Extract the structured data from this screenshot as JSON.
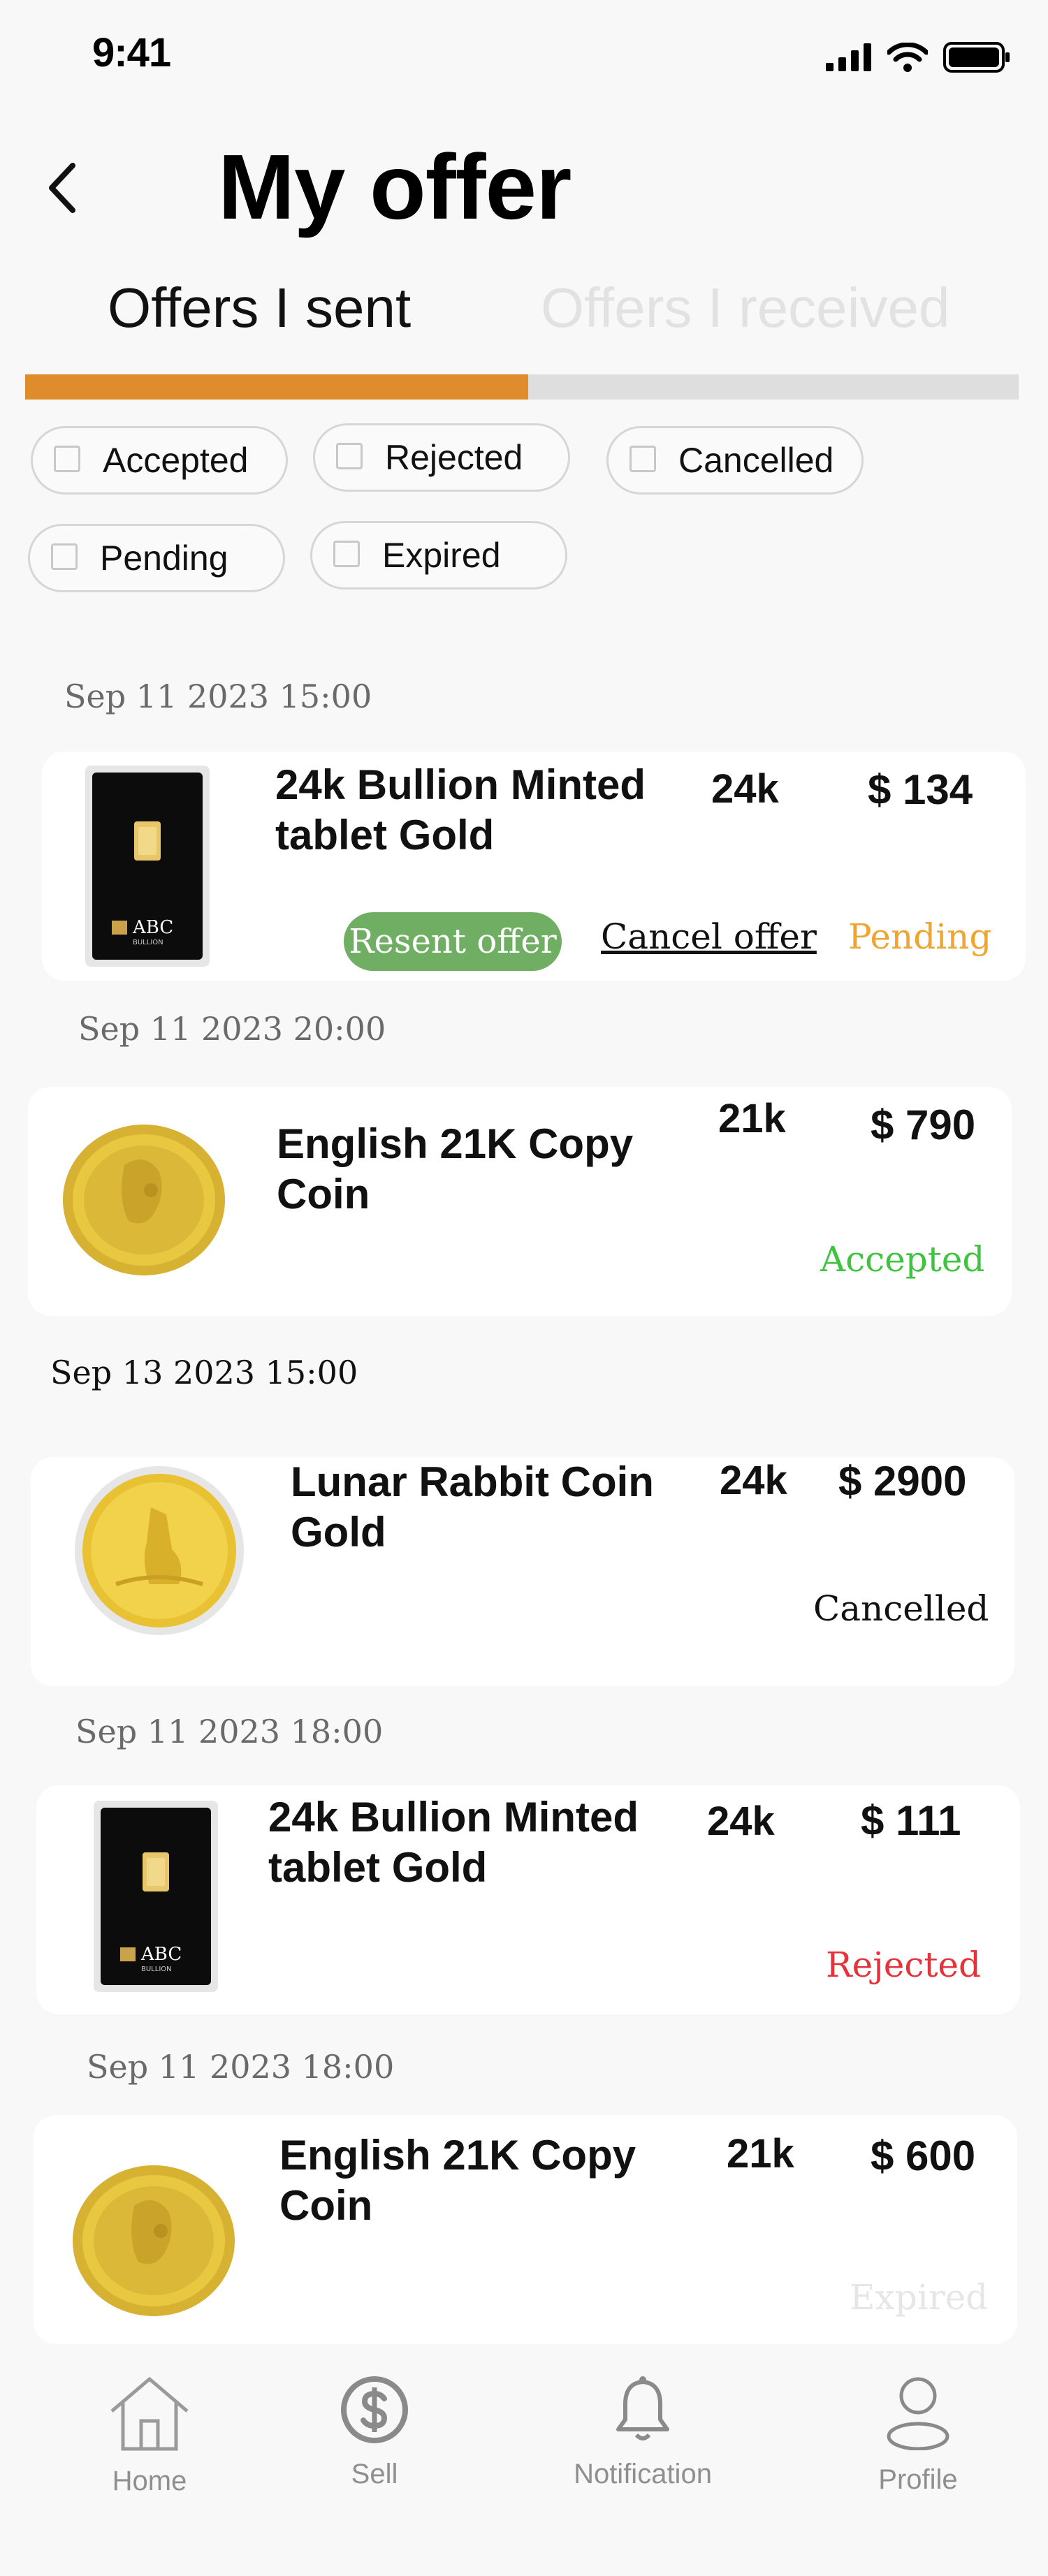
{
  "status_bar": {
    "time": "9:41"
  },
  "header": {
    "title": "My offer"
  },
  "tabs": [
    {
      "label": "Offers I sent",
      "active": true
    },
    {
      "label": "Offers I received",
      "active": false
    }
  ],
  "filters": [
    "Accepted",
    "Rejected",
    "Cancelled",
    "Pending",
    "Expired"
  ],
  "offers": [
    {
      "date": "Sep 11 2023 15:00",
      "title": "24k Bullion Minted tablet Gold",
      "karat": "24k",
      "price": "$ 134",
      "status": "Pending",
      "status_color": "#f0a531",
      "image": "gold-bar-image",
      "actions": {
        "resend": "Resent offer",
        "cancel": "Cancel offer"
      }
    },
    {
      "date": "Sep 11 2023 20:00",
      "title": "English 21K Copy Coin",
      "karat": "21k",
      "price": "$ 790",
      "status": "Accepted",
      "status_color": "#3ec43e",
      "image": "gold-coin-image"
    },
    {
      "date": "Sep 13 2023 15:00",
      "title": "Lunar Rabbit Coin Gold",
      "karat": "24k",
      "price": "$ 2900",
      "status": "Cancelled",
      "status_color": "#111111",
      "image": "rabbit-coin-image"
    },
    {
      "date": "Sep 11 2023 18:00",
      "title": "24k Bullion Minted tablet Gold",
      "karat": "24k",
      "price": "$ 111",
      "status": "Rejected",
      "status_color": "#e5323b",
      "image": "gold-bar-image"
    },
    {
      "date": "Sep 11 2023 18:00",
      "title": "English 21K Copy Coin",
      "karat": "21k",
      "price": "$ 600",
      "status": "Expired",
      "status_color": "#e6e6e6",
      "image": "gold-coin-image"
    }
  ],
  "bottom_nav": [
    {
      "label": "Home",
      "icon": "home-icon"
    },
    {
      "label": "Sell",
      "icon": "dollar-icon"
    },
    {
      "label": "Notification",
      "icon": "bell-icon"
    },
    {
      "label": "Profile",
      "icon": "user-icon"
    }
  ],
  "colors": {
    "accent": "#de8c2c",
    "pending": "#f0a531",
    "accepted": "#3ec43e",
    "rejected": "#e5323b",
    "resend_button": "#6fae63"
  }
}
